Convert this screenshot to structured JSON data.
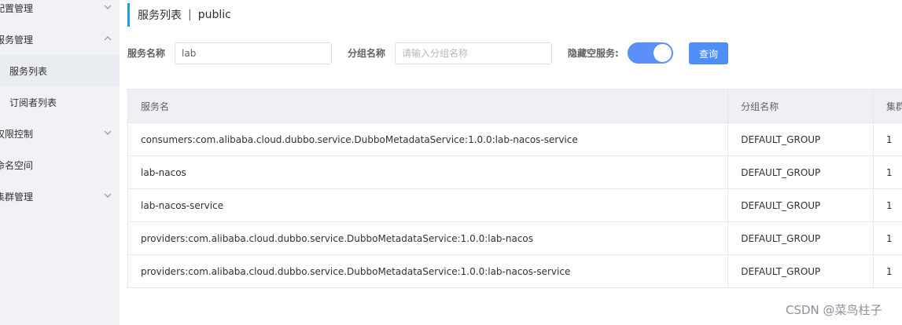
{
  "sidebar": {
    "items": [
      {
        "label": "配置管理",
        "expanded": false
      },
      {
        "label": "服务管理",
        "expanded": true
      },
      {
        "label": "服务列表"
      },
      {
        "label": "订阅者列表"
      },
      {
        "label": "权限控制",
        "expanded": false
      },
      {
        "label": "命名空间"
      },
      {
        "label": "集群管理",
        "expanded": false
      }
    ]
  },
  "header": {
    "title": "服务列表",
    "separator": "|",
    "namespace": "public"
  },
  "filters": {
    "service_name_label": "服务名称",
    "service_name_value": "lab",
    "group_name_label": "分组名称",
    "group_name_placeholder": "请输入分组名称",
    "hide_empty_label": "隐藏空服务:",
    "hide_empty_on": true,
    "query_button": "查询"
  },
  "table": {
    "columns": [
      "服务名",
      "分组名称",
      "集群"
    ],
    "rows": [
      {
        "name": "consumers:com.alibaba.cloud.dubbo.service.DubboMetadataService:1.0.0:lab-nacos-service",
        "group": "DEFAULT_GROUP",
        "clusters": "1"
      },
      {
        "name": "lab-nacos",
        "group": "DEFAULT_GROUP",
        "clusters": "1"
      },
      {
        "name": "lab-nacos-service",
        "group": "DEFAULT_GROUP",
        "clusters": "1"
      },
      {
        "name": "providers:com.alibaba.cloud.dubbo.service.DubboMetadataService:1.0.0:lab-nacos",
        "group": "DEFAULT_GROUP",
        "clusters": "1"
      },
      {
        "name": "providers:com.alibaba.cloud.dubbo.service.DubboMetadataService:1.0.0:lab-nacos-service",
        "group": "DEFAULT_GROUP",
        "clusters": "1"
      }
    ]
  },
  "watermark": "CSDN @菜鸟柱子",
  "colors": {
    "accent": "#1f9fd6",
    "toggle_on": "#5b8ff9",
    "button": "#4f8ef7",
    "sidebar_bg": "#f0f2f5"
  }
}
